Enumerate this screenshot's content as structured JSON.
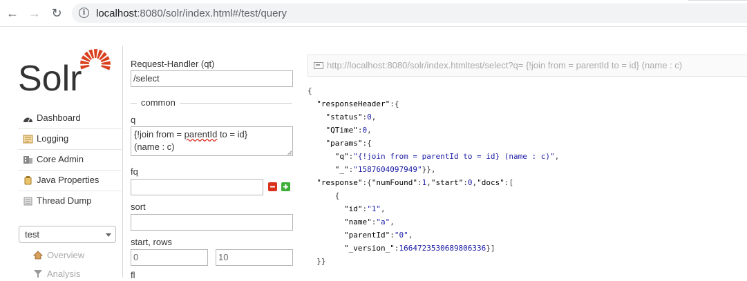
{
  "browser": {
    "url_host": "localhost",
    "url_rest": ":8080/solr/index.html#/test/query"
  },
  "sidebar": {
    "logo_text": "Solr",
    "items": [
      {
        "label": "Dashboard",
        "icon": "dashboard-icon"
      },
      {
        "label": "Logging",
        "icon": "logging-icon"
      },
      {
        "label": "Core Admin",
        "icon": "core-admin-icon"
      },
      {
        "label": "Java Properties",
        "icon": "java-properties-icon"
      },
      {
        "label": "Thread Dump",
        "icon": "thread-dump-icon"
      }
    ],
    "core_selector": {
      "selected": "test"
    },
    "core_items": [
      {
        "label": "Overview",
        "icon": "home-icon"
      },
      {
        "label": "Analysis",
        "icon": "funnel-icon"
      }
    ]
  },
  "form": {
    "request_handler_label": "Request-Handler (qt)",
    "request_handler_value": "/select",
    "common_legend": "common",
    "q_label": "q",
    "q_value_pre": "{!join from = ",
    "q_value_spell": "parentId",
    "q_value_post": " to = id}",
    "q_value_line2": "(name : c)",
    "fq_label": "fq",
    "fq_value": "",
    "sort_label": "sort",
    "sort_value": "",
    "start_rows_label": "start, rows",
    "start_value": "0",
    "rows_value": "10",
    "next_label": "fl"
  },
  "result": {
    "request_url": "http://localhost:8080/solr/index.htmltest/select?q= {!join from = parentId to = id} (name : c)",
    "json_lines": [
      "{",
      "  \"responseHeader\":{",
      "    \"status\":0,",
      "    \"QTime\":0,",
      "    \"params\":{",
      "      \"q\":\"{!join from = parentId to = id} (name : c)\",",
      "      \"_\":\"1587604097949\"}},",
      "  \"response\":{\"numFound\":1,\"start\":0,\"docs\":[",
      "      {",
      "        \"id\":\"1\",",
      "        \"name\":\"a\",",
      "        \"parentId\":\"0\",",
      "        \"_version_\":1664723530689806336}]",
      "  }}"
    ]
  },
  "colors": {
    "solr_orange": "#d9411e",
    "remove_red": "#d9311c",
    "add_green": "#3fae3a"
  }
}
